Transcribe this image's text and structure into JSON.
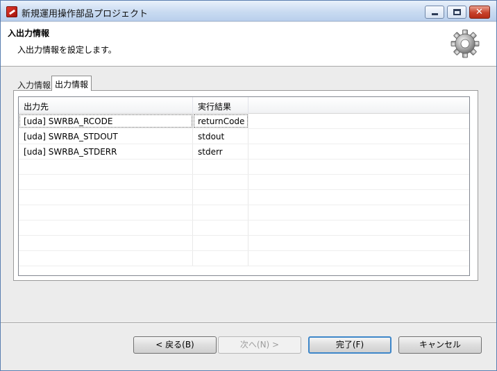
{
  "window": {
    "title": "新規運用操作部品プロジェクト",
    "controls": {
      "minimize": "minimize-icon",
      "maximize": "maximize-icon",
      "close": "✕"
    }
  },
  "banner": {
    "title": "入出力情報",
    "description": "入出力情報を設定します。",
    "icon": "gear-icon"
  },
  "tabs": [
    {
      "label": "入力情報",
      "active": false
    },
    {
      "label": "出力情報",
      "active": true
    }
  ],
  "table": {
    "columns": [
      "出力先",
      "実行結果",
      ""
    ],
    "rows": [
      [
        "[uda] SWRBA_RCODE",
        "returnCode",
        ""
      ],
      [
        "[uda] SWRBA_STDOUT",
        "stdout",
        ""
      ],
      [
        "[uda] SWRBA_STDERR",
        "stderr",
        ""
      ]
    ]
  },
  "buttons": {
    "back": "< 戻る(B)",
    "next": "次へ(N) >",
    "finish": "完了(F)",
    "cancel": "キャンセル"
  }
}
